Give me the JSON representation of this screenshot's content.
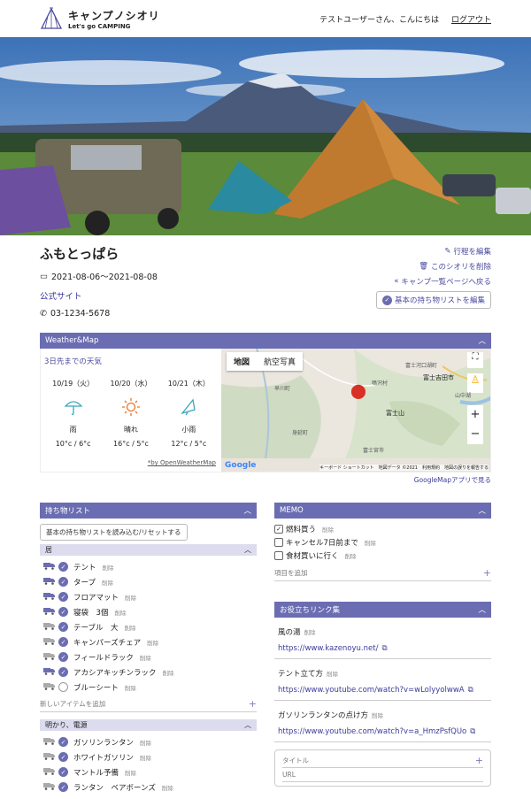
{
  "header": {
    "logo_title": "キャンプノシオリ",
    "logo_sub": "Let's go CAMPING",
    "greeting": "テストユーザーさん、こんにちは",
    "logout": "ログアウト"
  },
  "trip": {
    "title": "ふもとっぱら",
    "dates": "2021-08-06〜2021-08-08",
    "site_link": "公式サイト",
    "phone": "03-1234-5678"
  },
  "actions": {
    "edit": "行程を編集",
    "delete": "このシオリを削除",
    "back": "キャンプ一覧ページへ戻る",
    "edit_list": "基本の持ち物リストを編集"
  },
  "weather": {
    "panel_title": "Weather&Map",
    "forecast_title": "3日先までの天気",
    "credit": "*by OpenWeatherMap",
    "days": [
      {
        "date": "10/19（火）",
        "desc": "雨",
        "temp": "10°c / 6°c",
        "icon": "umbrella-icon"
      },
      {
        "date": "10/20（水）",
        "desc": "晴れ",
        "temp": "16°c / 5°c",
        "icon": "sun-icon"
      },
      {
        "date": "10/21（木）",
        "desc": "小雨",
        "temp": "12°c / 5°c",
        "icon": "light-rain-icon"
      }
    ]
  },
  "map": {
    "tab_map": "地図",
    "tab_aerial": "航空写真",
    "app_link": "GoogleMapアプリで見る",
    "google": "Google",
    "attribution": "キーボード ショートカット　地図データ ©2021　利用規約　地図の誤りを報告する",
    "labels": {
      "fujiyoshida": "富士吉田市",
      "fujisan": "富士山",
      "yamanaka": "山中湖",
      "fujikawaguchiko": "富士河口湖町",
      "narusawa": "鳴沢村",
      "hayakawa": "早川町",
      "minobu": "身延町",
      "fujinomiya": "富士宮市",
      "yamanashi": "山梨"
    }
  },
  "items": {
    "panel_title": "持ち物リスト",
    "load_button": "基本の持ち物リストを読み込む/リセットする",
    "delete_label": "削除",
    "add_placeholder": "新しいアイテムを追加",
    "groups": [
      {
        "name": "居",
        "items": [
          {
            "name": "テント",
            "checked": true,
            "truck": true
          },
          {
            "name": "タープ",
            "checked": true,
            "truck": true
          },
          {
            "name": "フロアマット",
            "checked": true,
            "truck": true
          },
          {
            "name": "寝袋　3個",
            "checked": true,
            "truck": true
          },
          {
            "name": "テーブル　大",
            "checked": true,
            "truck": false
          },
          {
            "name": "キャンパーズチェア",
            "checked": true,
            "truck": false
          },
          {
            "name": "フィールドラック",
            "checked": true,
            "truck": false
          },
          {
            "name": "アカシアキッチンラック",
            "checked": true,
            "truck": true
          },
          {
            "name": "ブルーシート",
            "checked": false,
            "truck": false
          }
        ]
      },
      {
        "name": "明かり、電源",
        "items": [
          {
            "name": "ガソリンランタン",
            "checked": true,
            "truck": false
          },
          {
            "name": "ホワイトガソリン",
            "checked": true,
            "truck": false
          },
          {
            "name": "マントル予備",
            "checked": true,
            "truck": false
          },
          {
            "name": "ランタン　ベアボーンズ",
            "checked": true,
            "truck": false
          }
        ]
      }
    ]
  },
  "memo": {
    "panel_title": "MEMO",
    "delete_label": "削除",
    "add_placeholder": "項目を追加",
    "items": [
      {
        "text": "燃料買う",
        "checked": true
      },
      {
        "text": "キャンセル7日前まで",
        "checked": false
      },
      {
        "text": "食材買いに行く",
        "checked": false
      }
    ]
  },
  "links": {
    "panel_title": "お役立ちリンク集",
    "delete_label": "削除",
    "title_placeholder": "タイトル",
    "url_placeholder": "URL",
    "items": [
      {
        "name": "風の湯",
        "url": "https://www.kazenoyu.net/"
      },
      {
        "name": "テント立て方",
        "url": "https://www.youtube.com/watch?v=wLolyyolwwA"
      },
      {
        "name": "ガソリンランタンの点け方",
        "url": "https://www.youtube.com/watch?v=a_HmzPsfQUo"
      }
    ]
  }
}
